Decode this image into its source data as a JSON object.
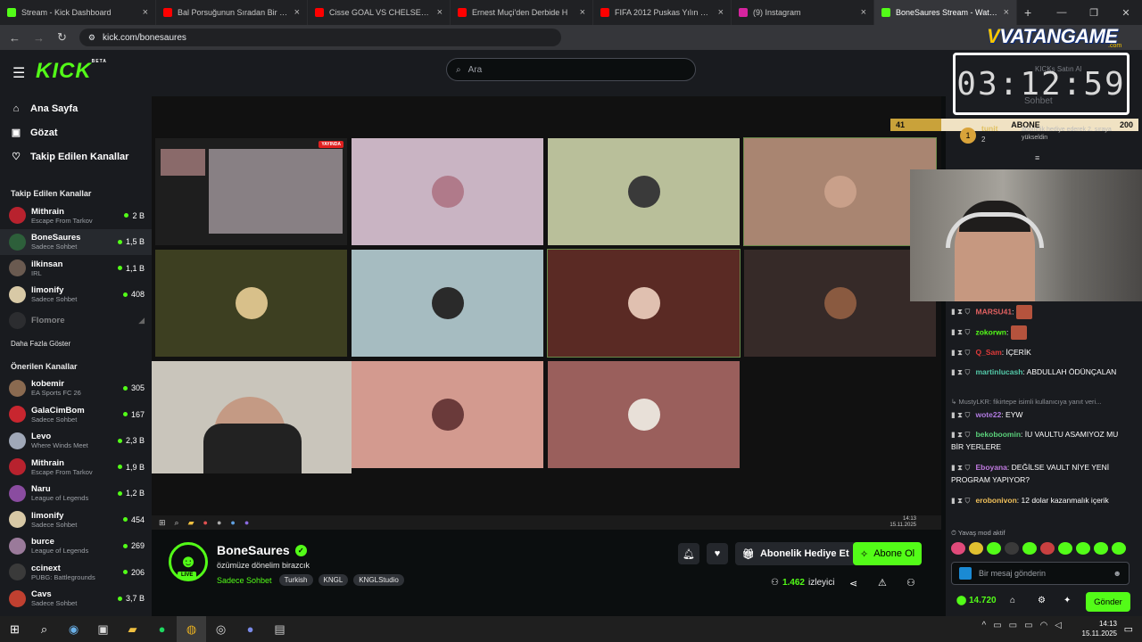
{
  "browser": {
    "tabs": [
      {
        "title": "Stream - Kick Dashboard",
        "color": "#53fc18"
      },
      {
        "title": "Bal Porsuğunun Sıradan Bir Gü",
        "color": "#ff0000"
      },
      {
        "title": "Cisse GOAL VS CHELSEA !!!!",
        "color": "#ff0000"
      },
      {
        "title": "Ernest Muçi'den Derbide H",
        "color": "#ff0000"
      },
      {
        "title": "FIFA 2012 Puskas Yılın Golü",
        "color": "#ff0000"
      },
      {
        "title": "(9) Instagram",
        "color": "#d6249f"
      },
      {
        "title": "BoneSaures Stream - Watch Li",
        "color": "#53fc18"
      }
    ],
    "url": "kick.com/bonesaures"
  },
  "header": {
    "logo": "KICK",
    "logo_badge": "BETA",
    "search_placeholder": "Ara"
  },
  "sidebar": {
    "nav": [
      {
        "label": "Ana Sayfa",
        "icon": "home-icon"
      },
      {
        "label": "Gözat",
        "icon": "browse-icon"
      },
      {
        "label": "Takip Edilen Kanallar",
        "icon": "heart-icon"
      }
    ],
    "followed_heading": "Takip Edilen Kanallar",
    "followed": [
      {
        "name": "Mithrain",
        "category": "Escape From Tarkov",
        "viewers": "2 B",
        "color": "#b8222e"
      },
      {
        "name": "BoneSaures",
        "category": "Sadece Sohbet",
        "viewers": "1,5 B",
        "color": "#2d5f3a"
      },
      {
        "name": "ilkinsan",
        "category": "IRL",
        "viewers": "1,1 B",
        "color": "#6a5a50"
      },
      {
        "name": "limonify",
        "category": "Sadece Sohbet",
        "viewers": "408",
        "color": "#d8c9a6"
      },
      {
        "name": "Flomore",
        "category": "",
        "viewers": "",
        "color": "#444"
      }
    ],
    "show_more": "Daha Fazla Göster",
    "recommended_heading": "Önerilen Kanallar",
    "recommended": [
      {
        "name": "kobemir",
        "category": "EA Sports FC 26",
        "viewers": "305",
        "color": "#8a6a50"
      },
      {
        "name": "GalaCimBom",
        "category": "Sadece Sohbet",
        "viewers": "167",
        "color": "#c8262f"
      },
      {
        "name": "Levo",
        "category": "Where Winds Meet",
        "viewers": "2,3 B",
        "color": "#a0a8b8"
      },
      {
        "name": "Mithrain",
        "category": "Escape From Tarkov",
        "viewers": "1,9 B",
        "color": "#b8222e"
      },
      {
        "name": "Naru",
        "category": "League of Legends",
        "viewers": "1,2 B",
        "color": "#8a4ca0"
      },
      {
        "name": "limonify",
        "category": "Sadece Sohbet",
        "viewers": "454",
        "color": "#d8c9a6"
      },
      {
        "name": "burce",
        "category": "League of Legends",
        "viewers": "269",
        "color": "#9a7a9a"
      },
      {
        "name": "ccinext",
        "category": "PUBG: Battlegrounds",
        "viewers": "206",
        "color": "#3a3a3a"
      },
      {
        "name": "Cavs",
        "category": "Sadece Sohbet",
        "viewers": "3,7 B",
        "color": "#c04030"
      }
    ]
  },
  "video": {
    "live_badge": "YAYINDA",
    "tiles": [
      {
        "bg": "#c9b4c3"
      },
      {
        "bg": "#b9bf9a"
      },
      {
        "bg": "#a98571"
      },
      {
        "bg": "#3d3f21"
      },
      {
        "bg": "#a6bcc1"
      },
      {
        "bg": "#5a2a24"
      },
      {
        "bg": "#362a28"
      },
      {
        "bg": "#d39a8f"
      },
      {
        "bg": "#9a5f5c"
      }
    ],
    "inner_clock_time": "14:13",
    "inner_clock_date": "15.11.2025"
  },
  "channel": {
    "name": "BoneSaures",
    "live_label": "LIVE",
    "title": "özümüze dönelim birazcık",
    "category": "Sadece Sohbet",
    "tags": [
      "Turkish",
      "KNGL",
      "KNGLStudio"
    ],
    "gift_label": "Abonelik Hediye Et",
    "subscribe_label": "Abone Ol",
    "viewers": "1.462",
    "viewers_label": "izleyici"
  },
  "overlay": {
    "brand_v": "V",
    "brand": "VATANGAME",
    "brand_suffix": ".com",
    "timer": "03:12:59",
    "timer_caption": "KICKs Satın Al",
    "timer_caption2": "Sohbet",
    "sub_goal_current": "41",
    "sub_goal_label": "ABONE",
    "sub_goal_target": "200",
    "sub_goal_fraction": 0.205
  },
  "chat": {
    "pinned_user": "tunit",
    "pinned_text": "abonelik hediye ederek 2. sıraya yükseldin",
    "pinned_count": "2",
    "messages": [
      {
        "user": "MARSU41",
        "text": "",
        "color": "#e06060",
        "emote": true
      },
      {
        "user": "zokorwn",
        "text": "",
        "color": "#53fc18",
        "emote": true
      },
      {
        "user": "Q_Sam",
        "text": "İÇERİK",
        "color": "#e03a3a",
        "emote": false
      },
      {
        "user": "martinlucash",
        "text": "ABDULLAH ÖDÜNÇALAN",
        "color": "#53c8a8",
        "emote": false
      },
      {
        "user": "wote22",
        "text": "EYW",
        "color": "#b07ae0",
        "emote": false
      },
      {
        "user": "bekoboomin",
        "text": "İU VAULTU ASAMIYOZ MU BİR YERLERE",
        "color": "#5ad07a",
        "emote": false
      },
      {
        "user": "Eboyana",
        "text": "DEĞİLSE VAULT NİYE YENİ PROGRAM YAPIYOR?",
        "color": "#c07ae0",
        "emote": false
      },
      {
        "user": "erobonivon",
        "text": "12 dolar kazanmalık içerik",
        "color": "#f0c05a",
        "emote": false
      }
    ],
    "reply_hint": "MustyLKR: fikirtepe isimli kullanıcıya yanıt veri...",
    "slow_mode": "Yavaş mod aktif",
    "input_placeholder": "Bir mesaj gönderin",
    "points": "14.720",
    "send_label": "Gönder"
  },
  "taskbar": {
    "time": "14:13",
    "date": "15.11.2025"
  }
}
